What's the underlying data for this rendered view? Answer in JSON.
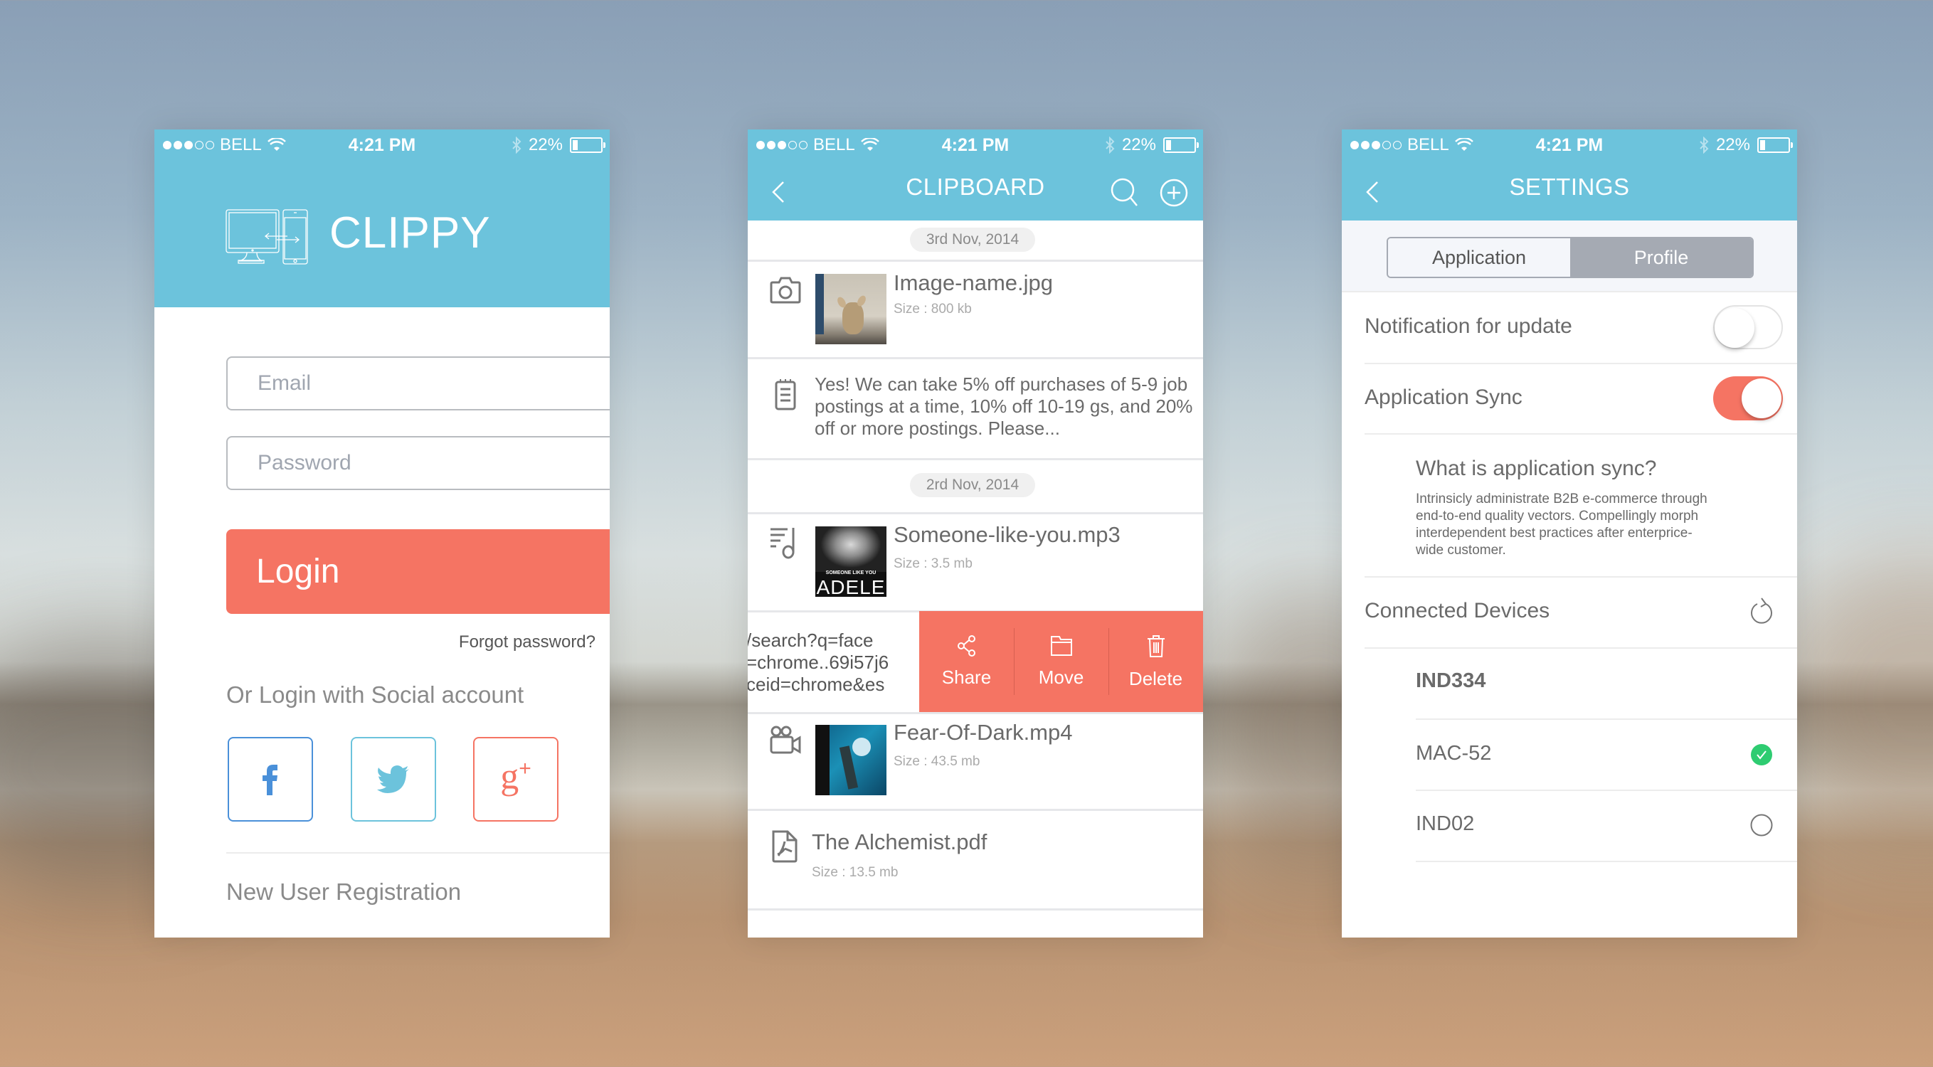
{
  "status_bar": {
    "carrier": "BELL",
    "time": "4:21 PM",
    "battery": "22%",
    "battery_level": 0.22,
    "signal_bars": 3,
    "signal_total": 5
  },
  "colors": {
    "accent_blue": "#6cc3dc",
    "accent_coral": "#f57463",
    "success_green": "#2ecc71",
    "facebook": "#4a90d9",
    "twitter": "#6cc3dc",
    "google": "#f57463"
  },
  "login_screen": {
    "app_name": "CLIPPY",
    "logo_icon": "devices-sync-icon",
    "email_placeholder": "Email",
    "password_placeholder": "Password",
    "login_label": "Login",
    "forgot_password": "Forgot password?",
    "social_title": "Or Login with Social account",
    "social": [
      {
        "name": "facebook",
        "glyph": "f"
      },
      {
        "name": "twitter",
        "glyph": "twitter-bird"
      },
      {
        "name": "google-plus",
        "glyph": "g+"
      }
    ],
    "register_label": "New User Registration"
  },
  "clipboard_screen": {
    "title": "CLIPBOARD",
    "groups": [
      {
        "date": "3rd Nov, 2014"
      },
      {
        "date": "2rd Nov, 2014"
      }
    ],
    "items": [
      {
        "type": "image",
        "icon": "camera-icon",
        "title": "Image-name.jpg",
        "size": "Size : 800 kb"
      },
      {
        "type": "text",
        "icon": "notepad-icon",
        "text": "Yes! We can take 5% off purchases of 5-9 job postings at a time, 10% off 10-19 gs, and 20% off or more postings. Please..."
      },
      {
        "type": "audio",
        "icon": "music-icon",
        "title": "Someone-like-you.mp3",
        "size": "Size : 3.5 mb",
        "album_caption": "SOMEONE LIKE YOU",
        "album_artist": "ADELE"
      },
      {
        "type": "link",
        "text_lines": [
          "/search?q=face",
          "=chrome..69i57j6",
          "ceid=chrome&es"
        ]
      },
      {
        "type": "video",
        "icon": "video-camera-icon",
        "title": "Fear-Of-Dark.mp4",
        "size": "Size : 43.5 mb"
      },
      {
        "type": "pdf",
        "icon": "pdf-icon",
        "title": "The Alchemist.pdf",
        "size": "Size : 13.5 mb"
      }
    ],
    "swipe_actions": [
      {
        "label": "Share",
        "icon": "share-icon"
      },
      {
        "label": "Move",
        "icon": "folder-icon"
      },
      {
        "label": "Delete",
        "icon": "trash-icon"
      }
    ]
  },
  "settings_screen": {
    "title": "SETTINGS",
    "tabs": [
      {
        "label": "Application",
        "active": false
      },
      {
        "label": "Profile",
        "active": true
      }
    ],
    "notification_label": "Notification for update",
    "notification_on": false,
    "sync_label": "Application Sync",
    "sync_on": true,
    "help_title": "What is application sync?",
    "help_text": "Intrinsicly administrate B2B e-commerce through end-to-end quality vectors. Compellingly morph interdependent best practices after enterprice-wide customer.",
    "devices_label": "Connected Devices",
    "devices": [
      {
        "name": "IND334",
        "status": "current"
      },
      {
        "name": "MAC-52",
        "status": "connected"
      },
      {
        "name": "IND02",
        "status": "disconnected"
      }
    ]
  }
}
